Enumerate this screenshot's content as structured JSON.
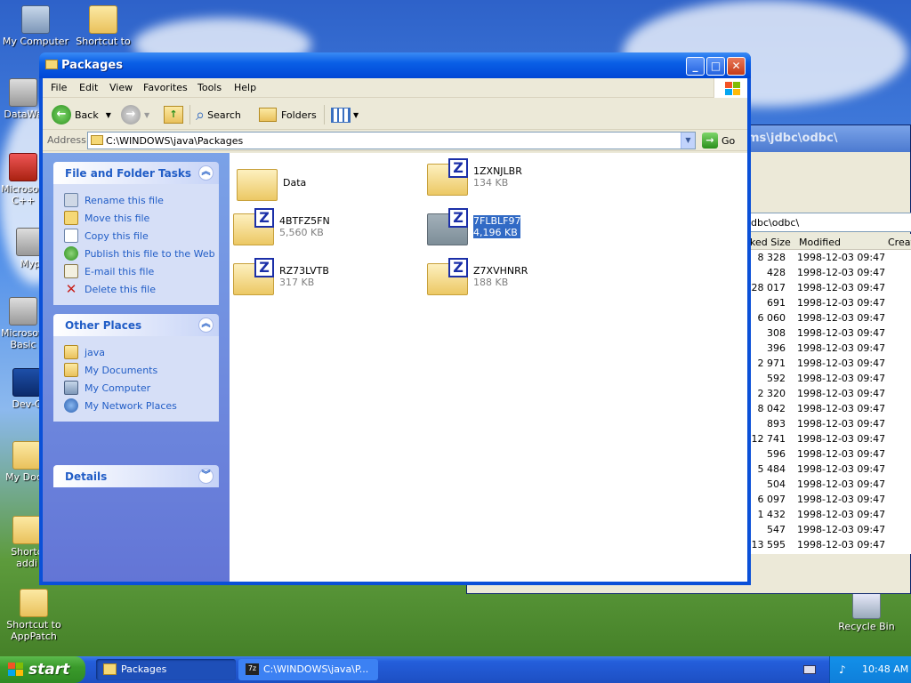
{
  "desktop": {
    "icons": [
      {
        "label": "My Computer"
      },
      {
        "label": "Shortcut to\nassembly"
      },
      {
        "label": "DataWa"
      },
      {
        "label": "Microsoft\nC++"
      },
      {
        "label": "Myp"
      },
      {
        "label": "Microsoft\nBasic"
      },
      {
        "label": "Dev-C"
      },
      {
        "label": "My Docu"
      },
      {
        "label": "Shortc\naddi"
      },
      {
        "label": "Shortcut to\nAppPatch"
      },
      {
        "label": "Recycle Bin"
      }
    ]
  },
  "bg_window": {
    "title_path": "ms\\jdbc\\odbc\\",
    "address": "dbc\\odbc\\",
    "headers": [
      "ked Size",
      "Modified",
      "Creat"
    ],
    "rows": [
      {
        "size": "8 328",
        "modified": "1998-12-03 09:47"
      },
      {
        "size": "428",
        "modified": "1998-12-03 09:47"
      },
      {
        "size": "28 017",
        "modified": "1998-12-03 09:47"
      },
      {
        "size": "691",
        "modified": "1998-12-03 09:47"
      },
      {
        "size": "6 060",
        "modified": "1998-12-03 09:47"
      },
      {
        "size": "308",
        "modified": "1998-12-03 09:47"
      },
      {
        "size": "396",
        "modified": "1998-12-03 09:47"
      },
      {
        "size": "2 971",
        "modified": "1998-12-03 09:47"
      },
      {
        "size": "592",
        "modified": "1998-12-03 09:47"
      },
      {
        "size": "2 320",
        "modified": "1998-12-03 09:47"
      },
      {
        "size": "8 042",
        "modified": "1998-12-03 09:47"
      },
      {
        "size": "893",
        "modified": "1998-12-03 09:47"
      },
      {
        "size": "12 741",
        "modified": "1998-12-03 09:47"
      },
      {
        "size": "596",
        "modified": "1998-12-03 09:47"
      },
      {
        "size": "5 484",
        "modified": "1998-12-03 09:47"
      },
      {
        "size": "504",
        "modified": "1998-12-03 09:47"
      },
      {
        "size": "6 097",
        "modified": "1998-12-03 09:47"
      },
      {
        "size": "1 432",
        "modified": "1998-12-03 09:47"
      },
      {
        "size": "547",
        "modified": "1998-12-03 09:47"
      },
      {
        "size": "13 595",
        "modified": "1998-12-03 09:47"
      }
    ]
  },
  "window": {
    "title": "Packages",
    "menu": [
      "File",
      "Edit",
      "View",
      "Favorites",
      "Tools",
      "Help"
    ],
    "toolbar": {
      "back": "Back",
      "search": "Search",
      "folders": "Folders"
    },
    "address": {
      "label": "Address",
      "value": "C:\\WINDOWS\\java\\Packages",
      "go": "Go"
    },
    "tasks": {
      "file_folder": {
        "title": "File and Folder Tasks",
        "items": [
          "Rename this file",
          "Move this file",
          "Copy this file",
          "Publish this file to the Web",
          "E-mail this file",
          "Delete this file"
        ]
      },
      "other_places": {
        "title": "Other Places",
        "items": [
          "java",
          "My Documents",
          "My Computer",
          "My Network Places"
        ]
      },
      "details": {
        "title": "Details"
      }
    },
    "files": [
      {
        "name": "Data",
        "size": ""
      },
      {
        "name": "1ZXNJLBR",
        "size": "134 KB"
      },
      {
        "name": "4BTFZ5FN",
        "size": "5,560 KB"
      },
      {
        "name": "7FLBLF97",
        "size": "4,196 KB",
        "selected": true
      },
      {
        "name": "RZ73LVTB",
        "size": "317 KB"
      },
      {
        "name": "Z7XVHNRR",
        "size": "188 KB"
      }
    ]
  },
  "taskbar": {
    "start": "start",
    "tasks": [
      "Packages",
      "C:\\WINDOWS\\java\\P..."
    ],
    "clock": "10:48 AM"
  }
}
